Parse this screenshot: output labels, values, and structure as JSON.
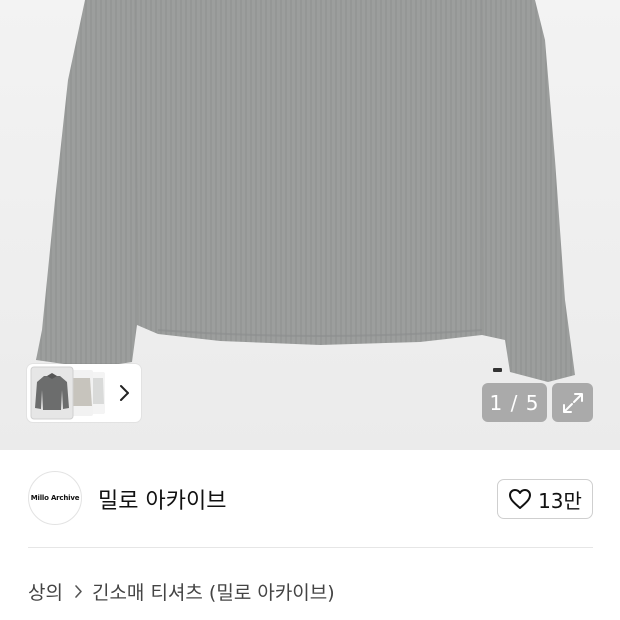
{
  "product_image": {
    "description_icon": "sweater-photo",
    "counter": "1 / 5",
    "expand_icon": "expand-icon",
    "thumbnail_nav_icon": "chevron-right-icon",
    "thumbnail_count_visible": 3
  },
  "seller": {
    "avatar_text": "Millo Archive",
    "name": "밀로 아카이브"
  },
  "like": {
    "icon": "heart-icon",
    "count": "13만"
  },
  "breadcrumb": {
    "category": "상의",
    "separator_icon": "chevron-right-icon",
    "title": "긴소매 티셔츠 (밀로 아카이브)"
  },
  "colors": {
    "sweater": "#9a9c9b",
    "background": "#eeeeee",
    "overlay": "rgba(0,0,0,0.28)"
  }
}
